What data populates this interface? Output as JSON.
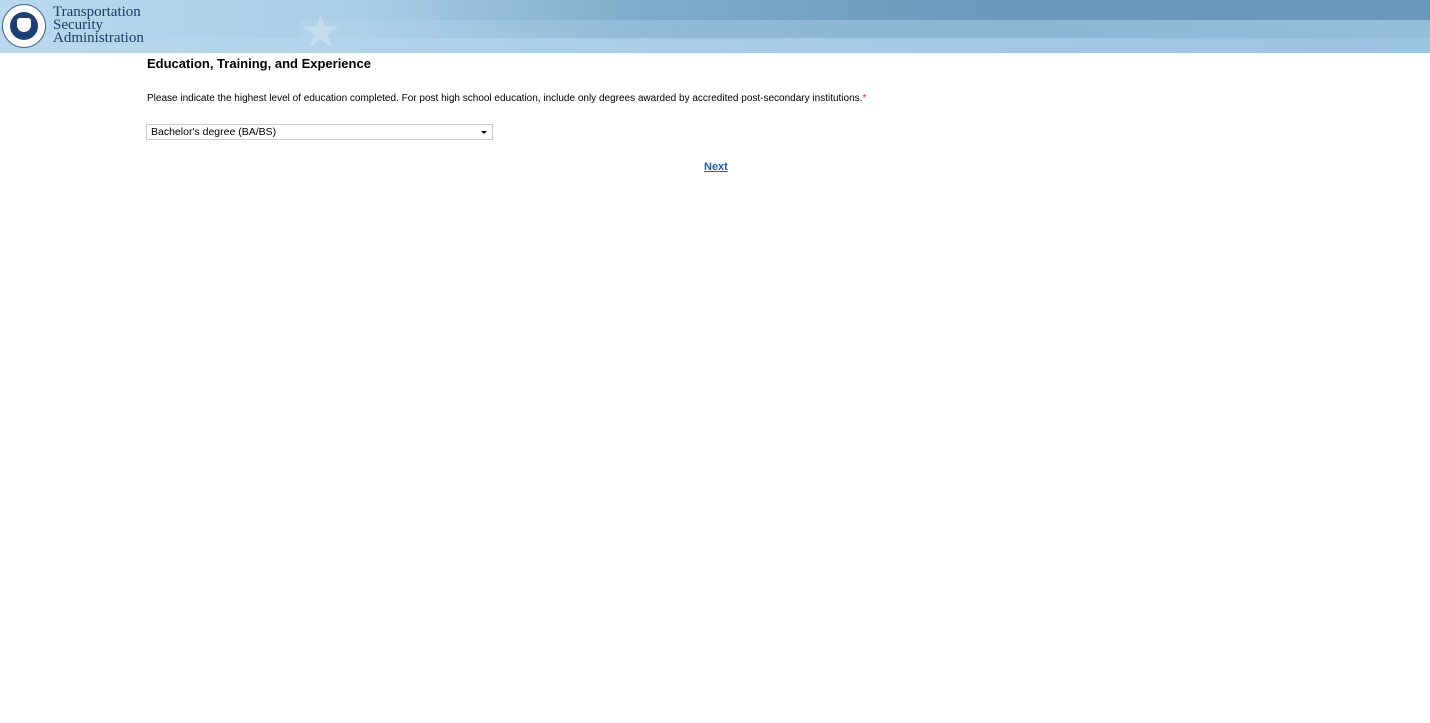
{
  "header": {
    "brand_lines": [
      "Transportation",
      "Security",
      "Administration"
    ],
    "seal": "dhs-seal-icon"
  },
  "section": {
    "title": "Education, Training, and Experience"
  },
  "question": {
    "text": "Please indicate the highest level of education completed. For post high school education, include only degrees awarded by accredited post-secondary institutions.",
    "required_marker": "*"
  },
  "education_select": {
    "value": "Bachelor's degree (BA/BS)"
  },
  "nav": {
    "next_label": "Next"
  },
  "colors": {
    "link": "#1f5fad",
    "required": "#dd2222",
    "brand_text": "#1c3a68"
  }
}
